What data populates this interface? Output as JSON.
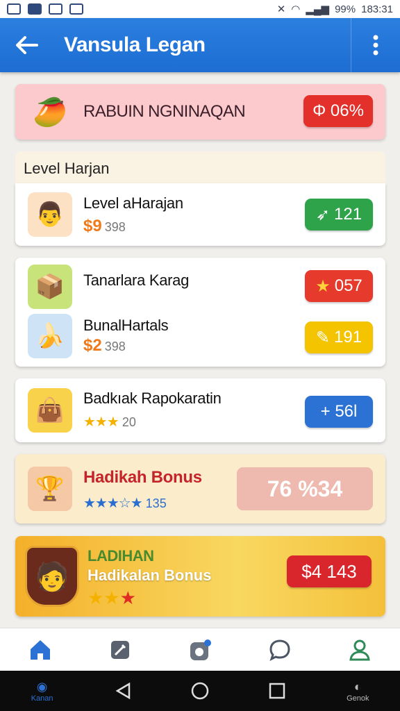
{
  "status_bar": {
    "battery": "99%",
    "time": "183:31"
  },
  "app_bar": {
    "title": "Vansula Legan"
  },
  "promo": {
    "title": "RABUIN NGNINAQAN",
    "badge": "Φ 06%"
  },
  "section_header": "Level Harjan",
  "items": [
    {
      "title": "Level aHarajan",
      "price": "$9",
      "sub": "398",
      "badge": "121",
      "badge_color": "#2ea34a",
      "icon": "person-icon"
    },
    {
      "title": "Tanarlara Karag",
      "badge": "057",
      "badge_color": "#e53a2c",
      "icon": "chest-icon"
    },
    {
      "title": "BunalHartals",
      "price": "$2",
      "sub": "398",
      "badge": "191",
      "badge_color": "#f5c400",
      "icon": "banana-icon"
    },
    {
      "title": "Badkıak Rapokaratin",
      "stars": "★★★",
      "sub": "20",
      "badge": "+ 56l",
      "badge_color": "#2b72d4",
      "icon": "bag-icon"
    }
  ],
  "bonus": {
    "title": "Hadikah Bonus",
    "stars": "★★★☆★",
    "count": "135",
    "badge": "76 %34"
  },
  "bonus2": {
    "label_top": "LADIHAN",
    "title": "Hadikalan Bonus",
    "badge": "$4 143"
  },
  "bottom_nav": [
    "home-icon",
    "edit-icon",
    "badge-icon",
    "chat-icon",
    "profile-icon"
  ],
  "sys_nav": {
    "left_label": "Kanan",
    "right_label": "Genok"
  },
  "colors": {
    "primary": "#1d6dd3",
    "promo_bg": "#fcc9cc",
    "bonus_bg": "#fbeccb",
    "bonus2_bg": "#f5c53a"
  }
}
